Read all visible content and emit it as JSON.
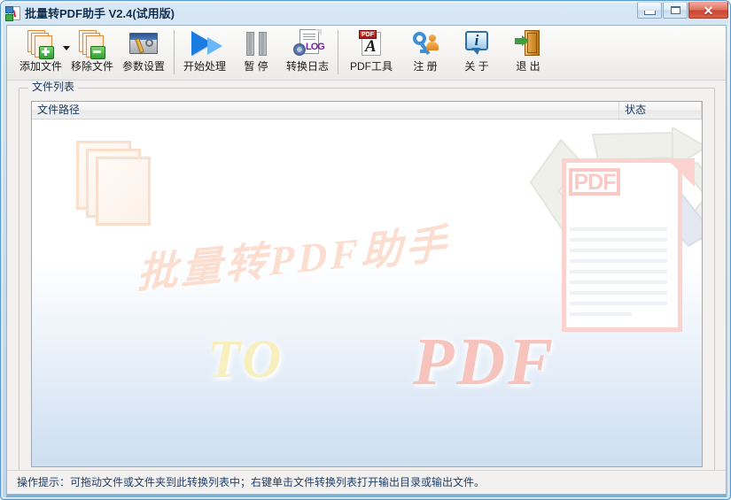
{
  "window": {
    "title": "批量转PDF助手 V2.4(试用版)",
    "icon": "pdf-app-icon",
    "controls": {
      "minimize": "minimize-icon",
      "maximize": "maximize-icon",
      "close": "✕"
    }
  },
  "toolbar": {
    "buttons": [
      {
        "label": "添加文件",
        "icon": "add-files-icon",
        "has_dropdown": true
      },
      {
        "label": "移除文件",
        "icon": "remove-files-icon",
        "has_dropdown": false
      },
      {
        "label": "参数设置",
        "icon": "settings-icon",
        "has_dropdown": false
      },
      {
        "label": "开始处理",
        "icon": "play-icon",
        "has_dropdown": false
      },
      {
        "label": "暂 停",
        "icon": "pause-icon",
        "has_dropdown": false
      },
      {
        "label": "转换日志",
        "icon": "log-icon",
        "has_dropdown": false
      },
      {
        "label": "PDF工具",
        "icon": "pdf-tool-icon",
        "has_dropdown": false
      },
      {
        "label": "注 册",
        "icon": "key-icon",
        "has_dropdown": false
      },
      {
        "label": "关 于",
        "icon": "info-icon",
        "has_dropdown": false
      },
      {
        "label": "退 出",
        "icon": "exit-icon",
        "has_dropdown": false
      }
    ]
  },
  "file_list": {
    "group_label": "文件列表",
    "columns": [
      {
        "key": "path",
        "label": "文件路径"
      },
      {
        "key": "status",
        "label": "状态"
      }
    ],
    "rows": []
  },
  "watermark": {
    "chinese": "批量转PDF助手",
    "to": "TO",
    "pdf": "PDF",
    "doc_label": "PDF",
    "pdf_tool_tag": "PDF"
  },
  "statusbar": {
    "text": "操作提示：可拖动文件或文件夹到此转换列表中；右键单击文件转换列表打开输出目录或输出文件。"
  },
  "colors": {
    "title_text": "#0b2c52",
    "status_text": "#1f3f6b",
    "accent_blue": "#6fb4df",
    "close_red": "#c94431",
    "play_blue": "#1a7ce0",
    "watermark_pink": "#f6c3bd",
    "watermark_yellow": "#f8efbf"
  }
}
